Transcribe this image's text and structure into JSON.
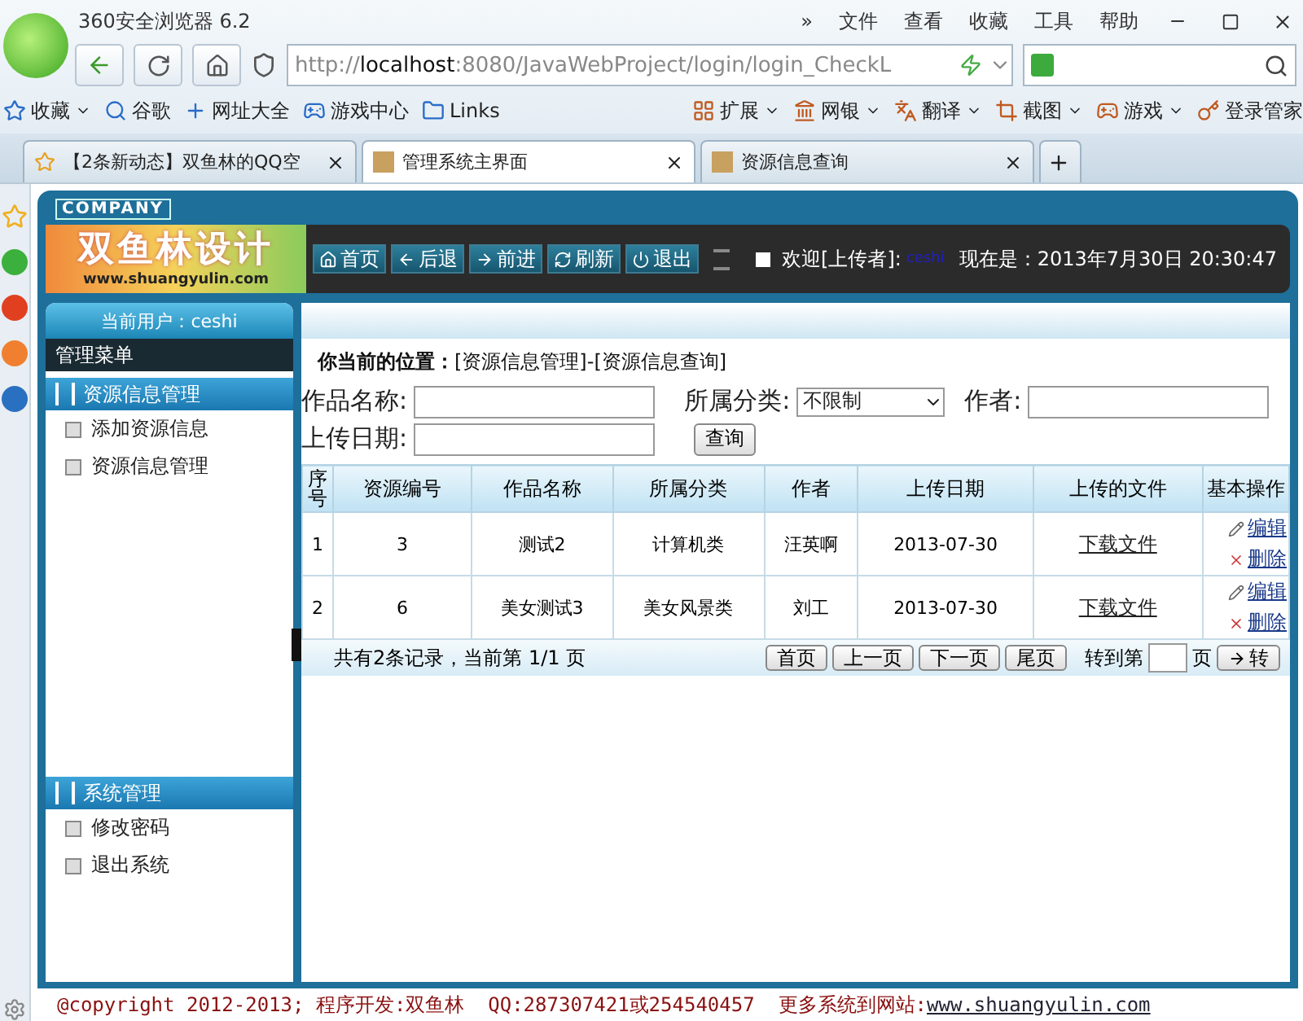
{
  "browser": {
    "title": "360安全浏览器 6.2",
    "menu": [
      "»",
      "文件",
      "查看",
      "收藏",
      "工具",
      "帮助"
    ],
    "address": {
      "host_prefix": "http://",
      "host": "localhost",
      "rest": ":8080/JavaWebProject/login/login_CheckL"
    },
    "bookmarks": [
      {
        "label": "收藏",
        "kind": "star",
        "caret": true
      },
      {
        "label": "谷歌",
        "kind": "google",
        "caret": false
      },
      {
        "label": "网址大全",
        "kind": "plus",
        "caret": false
      },
      {
        "label": "游戏中心",
        "kind": "game",
        "caret": false
      },
      {
        "label": "Links",
        "kind": "folder",
        "caret": false
      }
    ],
    "tools": [
      {
        "label": "扩展",
        "kind": "grid",
        "caret": true
      },
      {
        "label": "网银",
        "kind": "bank",
        "caret": true
      },
      {
        "label": "翻译",
        "kind": "translate",
        "caret": true
      },
      {
        "label": "截图",
        "kind": "crop",
        "caret": true
      },
      {
        "label": "游戏",
        "kind": "game",
        "caret": true
      },
      {
        "label": "登录管家",
        "kind": "key",
        "caret": false
      }
    ],
    "tabs": [
      {
        "label": "【2条新动态】双鱼林的QQ空",
        "selected": false,
        "kind": "star"
      },
      {
        "label": "管理系统主界面",
        "selected": true,
        "kind": "page"
      },
      {
        "label": "资源信息查询",
        "selected": false,
        "kind": "page"
      }
    ]
  },
  "page": {
    "company": "COMPANY",
    "logo": {
      "name": "双鱼林设计",
      "site": "www.shuangyulin.com"
    },
    "toolbar": [
      {
        "label": "首页",
        "kind": "home"
      },
      {
        "label": "后退",
        "kind": "back"
      },
      {
        "label": "前进",
        "kind": "forward"
      },
      {
        "label": "刷新",
        "kind": "refresh"
      },
      {
        "label": "退出",
        "kind": "power"
      }
    ],
    "welcome": "欢迎[上传者]:",
    "welcome_user": "ceshi",
    "now": "现在是：2013年7月30日 20:30:47",
    "current_user": "当前用户：ceshi",
    "menu_title": "管理菜单",
    "groups": [
      {
        "title": "资源信息管理",
        "items": [
          "添加资源信息",
          "资源信息管理"
        ]
      },
      {
        "title": "系统管理",
        "items": [
          "修改密码",
          "退出系统"
        ]
      }
    ],
    "breadcrumb": "**你当前的位置：**[资源信息管理]-[资源信息查询]",
    "form": {
      "name_label": "作品名称:",
      "category_label": "所属分类:",
      "category_value": "不限制",
      "author_label": "作者:",
      "date_label": "上传日期:",
      "search_button": "查询"
    },
    "table": {
      "columns": [
        "序号",
        "资源编号",
        "作品名称",
        "所属分类",
        "作者",
        "上传日期",
        "上传的文件",
        "基本操作"
      ],
      "rows": [
        {
          "cells": [
            "1",
            "3",
            "测试2",
            "计算机类",
            "汪英啊",
            "2013-07-30"
          ],
          "file": "下载文件",
          "edit": "编辑",
          "delete": "删除"
        },
        {
          "cells": [
            "2",
            "6",
            "美女测试3",
            "美女风景类",
            "刘工",
            "2013-07-30"
          ],
          "file": "下载文件",
          "edit": "编辑",
          "delete": "删除"
        }
      ]
    },
    "pager": {
      "summary": "共有2条记录，当前第 1/1 页",
      "buttons": [
        "首页",
        "上一页",
        "下一页",
        "尾页"
      ],
      "goto": "转到第",
      "page_unit": "页",
      "go": "转"
    },
    "footer": {
      "text": "@copyright 2012-2013; 程序开发:双鱼林  QQ:287307421或254540457  更多系统到网站:",
      "link": "www.shuangyulin.com"
    }
  }
}
